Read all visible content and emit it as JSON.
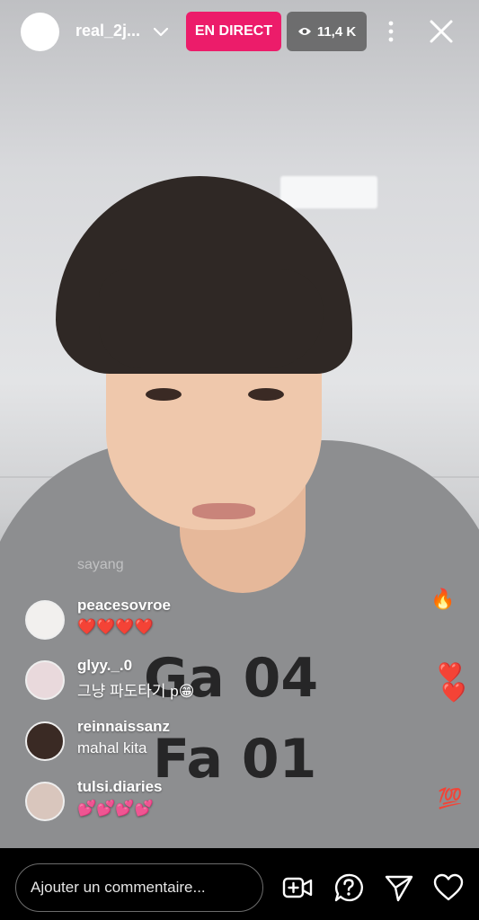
{
  "header": {
    "username": "real_2j...",
    "live_label": "EN DIRECT",
    "viewer_count": "11,4 K"
  },
  "overlay": {
    "watermark": "sayang"
  },
  "comments": [
    {
      "user": "peacesovroe",
      "text": "❤️❤️❤️❤️"
    },
    {
      "user": "glyy._.0",
      "text": "그냥 파도타기 p😁"
    },
    {
      "user": "reinnaissanz",
      "text": "mahal kita"
    },
    {
      "user": "tulsi.diaries",
      "text": "💕💕💕💕"
    }
  ],
  "reactions": {
    "fire": "🔥",
    "heart_a": "❤️",
    "heart_b": "❤️",
    "hundred": "💯"
  },
  "footer": {
    "comment_placeholder": "Ajouter un commentaire..."
  },
  "shirt_text": {
    "line1": "Ga 04",
    "line2": "Fa 01"
  }
}
